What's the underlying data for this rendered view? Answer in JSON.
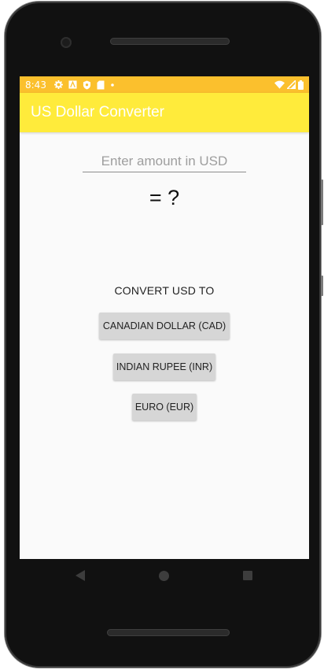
{
  "status_bar": {
    "time": "8:43",
    "icons_left": [
      "gear-icon",
      "a-box-icon",
      "shield-icon",
      "sd-card-icon",
      "dot-icon"
    ],
    "icons_right": [
      "wifi-icon",
      "signal-icon",
      "battery-icon"
    ],
    "color": "#fbc02d"
  },
  "app_bar": {
    "title": "US Dollar Converter",
    "color": "#ffeb3b"
  },
  "amount_input": {
    "value": "",
    "placeholder": "Enter amount in USD"
  },
  "result_text": "= ?",
  "convert_label": "CONVERT USD TO",
  "buttons": {
    "cad": "CANADIAN DOLLAR (CAD)",
    "inr": "INDIAN RUPEE (INR)",
    "eur": "EURO (EUR)"
  },
  "nav": [
    "back-icon",
    "home-icon",
    "recents-icon"
  ]
}
